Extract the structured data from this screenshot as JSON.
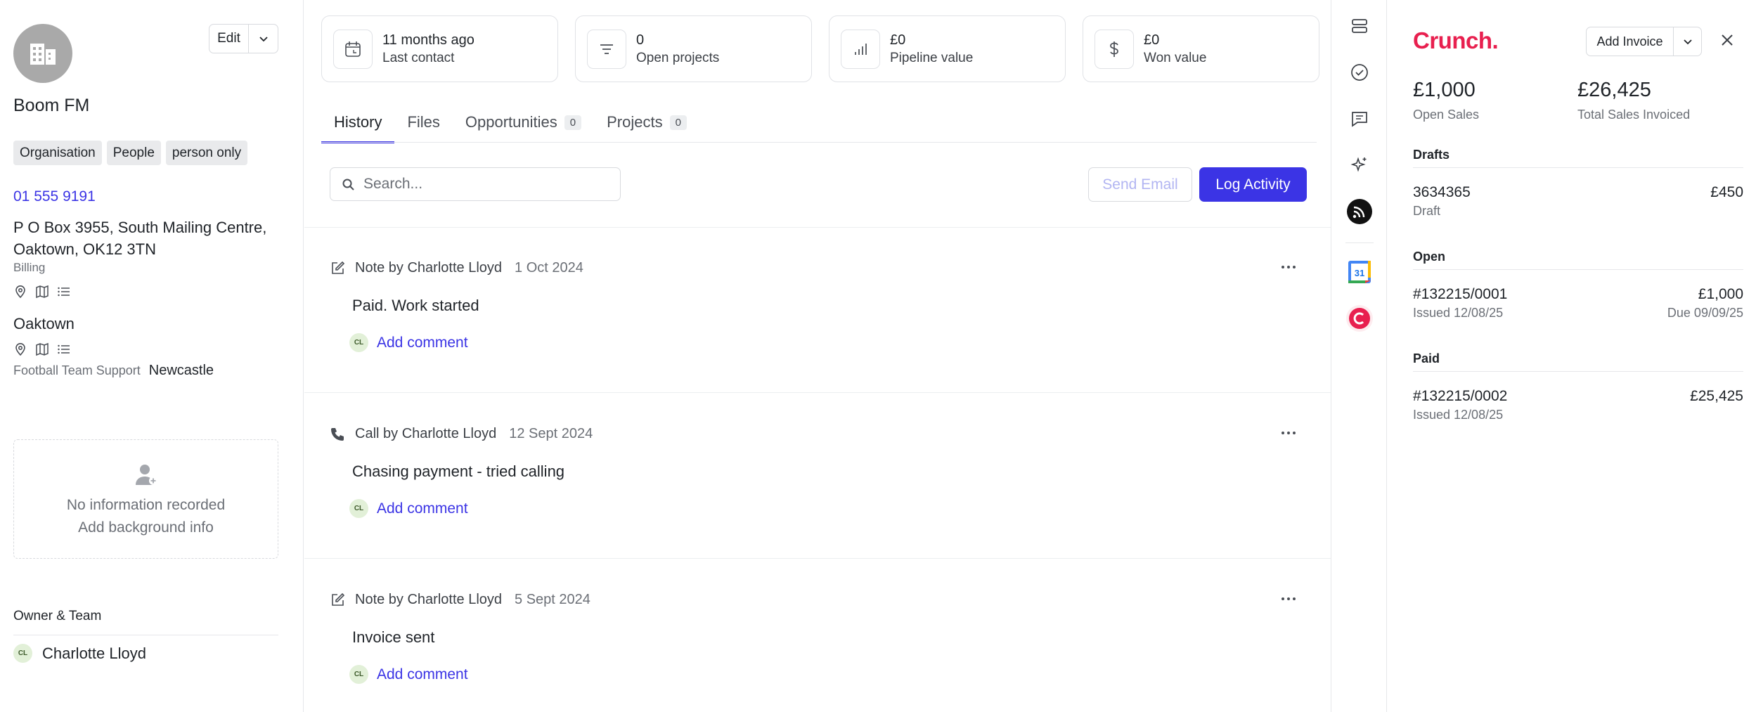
{
  "contact": {
    "company_name": "Boom FM",
    "edit_label": "Edit",
    "tags": [
      "Organisation",
      "People",
      "person only"
    ],
    "phone": "01 555 9191",
    "address": "P O Box 3955, South Mailing Centre, Oaktown, OK12 3TN",
    "address_type": "Billing",
    "city": "Oaktown",
    "custom_field": {
      "label": "Football Team Support",
      "value": "Newcastle"
    },
    "background": {
      "empty_text": "No information recorded",
      "add_text": "Add background info"
    },
    "owner_heading": "Owner & Team",
    "owner": {
      "initials": "CL",
      "name": "Charlotte Lloyd"
    }
  },
  "stats": [
    {
      "value": "11 months ago",
      "label": "Last contact",
      "icon": "calendar-icon"
    },
    {
      "value": "0",
      "label": "Open projects",
      "icon": "lines-icon"
    },
    {
      "value": "£0",
      "label": "Pipeline value",
      "icon": "bar-chart-icon"
    },
    {
      "value": "£0",
      "label": "Won value",
      "icon": "dollar-icon"
    }
  ],
  "tabs": [
    {
      "label": "History",
      "count": null,
      "active": true
    },
    {
      "label": "Files",
      "count": null
    },
    {
      "label": "Opportunities",
      "count": "0"
    },
    {
      "label": "Projects",
      "count": "0"
    }
  ],
  "search": {
    "placeholder": "Search..."
  },
  "actions": {
    "send_email": "Send Email",
    "log_activity": "Log Activity"
  },
  "activities": [
    {
      "type": "note",
      "title": "Note by Charlotte Lloyd",
      "date": "1 Oct 2024",
      "body": "Paid. Work started",
      "comment_label": "Add comment",
      "initials": "CL"
    },
    {
      "type": "call",
      "title": "Call by Charlotte Lloyd",
      "date": "12 Sept 2024",
      "body": "Chasing payment - tried calling",
      "comment_label": "Add comment",
      "initials": "CL"
    },
    {
      "type": "note",
      "title": "Note by Charlotte Lloyd",
      "date": "5 Sept 2024",
      "body": "Invoice sent",
      "comment_label": "Add comment",
      "initials": "CL"
    }
  ],
  "rail": {
    "calendar_day": "31",
    "icons": [
      "layers-icon",
      "check-circle-icon",
      "chat-icon",
      "sparkle-icon",
      "feed-app-icon",
      "google-calendar-icon",
      "crunch-app-icon"
    ]
  },
  "crunch": {
    "brand": "Crunch.",
    "brand_color": "#e8204f",
    "add_invoice": "Add Invoice",
    "open_sales": {
      "value": "£1,000",
      "label": "Open Sales"
    },
    "total_invoiced": {
      "value": "£26,425",
      "label": "Total Sales Invoiced"
    },
    "sections": {
      "drafts": "Drafts",
      "open": "Open",
      "paid": "Paid"
    },
    "drafts": [
      {
        "number": "3634365",
        "status": "Draft",
        "amount": "£450"
      }
    ],
    "open": [
      {
        "number": "#132215/0001",
        "issued": "Issued 12/08/25",
        "amount": "£1,000",
        "due": "Due 09/09/25"
      }
    ],
    "paid": [
      {
        "number": "#132215/0002",
        "issued": "Issued 12/08/25",
        "amount": "£25,425"
      }
    ]
  },
  "colors": {
    "accent": "#3b34e5",
    "brand": "#e8204f"
  }
}
